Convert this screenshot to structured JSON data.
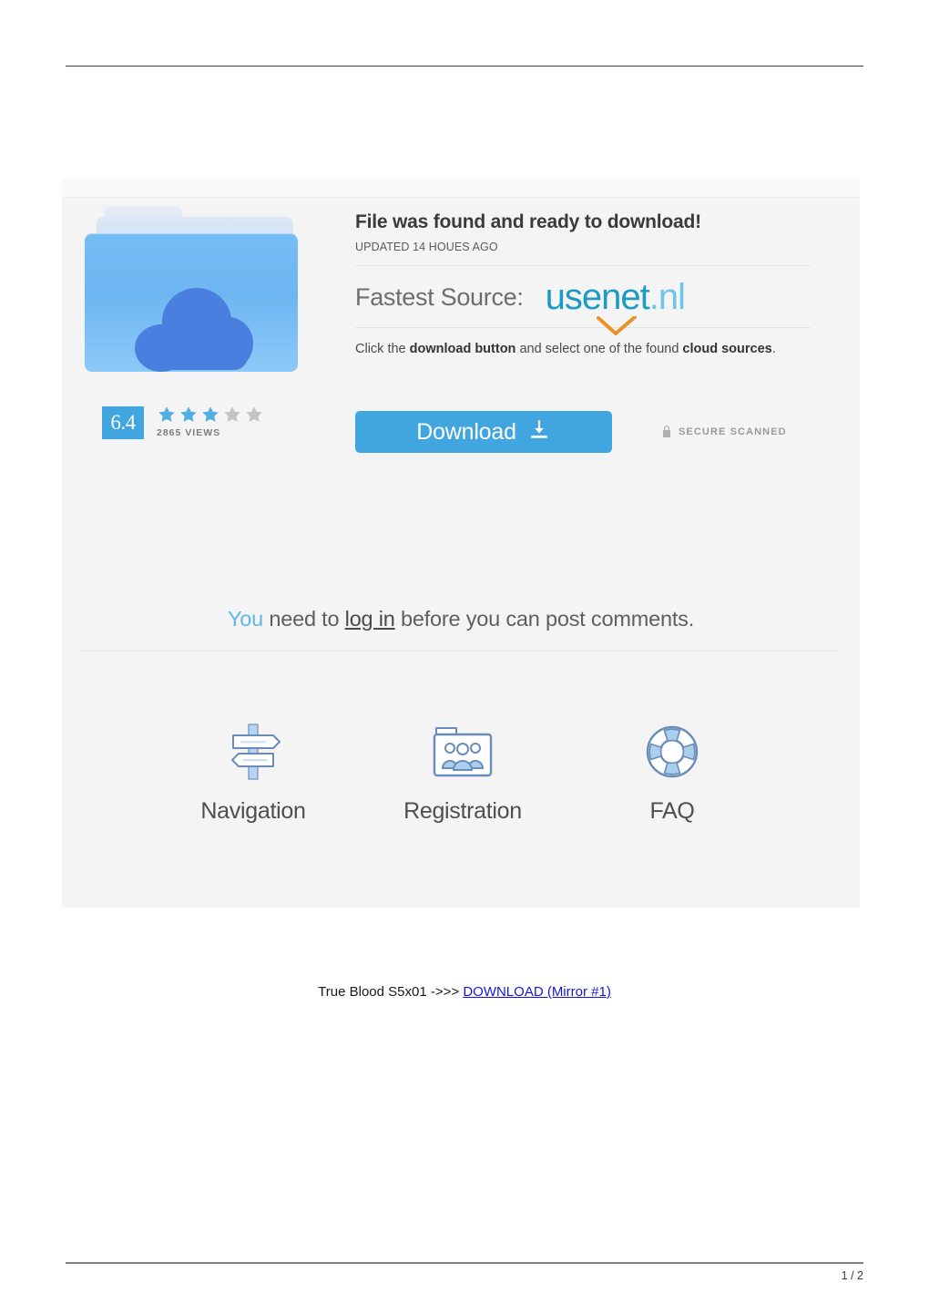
{
  "document": {
    "page_number": "1 / 2"
  },
  "ad": {
    "folder_icon": "cloud-folder-icon",
    "headline": "File was found and ready to download!",
    "updated": "UPDATED 14 HOUES AGO",
    "source_label": "Fastest Source:",
    "logo": {
      "name": "usenet-nl-logo",
      "part1": "usenet",
      "part2": ".nl",
      "color1": "#1d9bc4",
      "color2": "#6cc5e8",
      "check_color": "#e8922a"
    },
    "description": {
      "p1": "Click the ",
      "b1": "download button",
      "p2": " and select one of the found ",
      "b2": "cloud sources",
      "p3": "."
    },
    "rating": {
      "score": "6.4",
      "stars_filled": 3,
      "stars_total": 5,
      "views": "2865 VIEWS",
      "badge_color": "#41a6e0",
      "star_filled_color": "#53aee2",
      "star_empty_color": "#c3c3c3"
    },
    "download": {
      "label": "Download",
      "icon": "download-icon",
      "color": "#41a6e0"
    },
    "secure": {
      "icon": "lock-icon",
      "label": "SECURE SCANNED"
    },
    "login_message": {
      "you": "You",
      "mid": " need to ",
      "link": "log in",
      "tail": " before you can post comments."
    },
    "features": [
      {
        "icon": "signpost-icon",
        "label": "Navigation"
      },
      {
        "icon": "folder-people-icon",
        "label": "Registration"
      },
      {
        "icon": "life-ring-icon",
        "label": "FAQ"
      }
    ]
  },
  "caption": {
    "text": "True Blood S5x01 ->>> ",
    "link_text": "DOWNLOAD (Mirror #1)",
    "link_color": "#1414e6"
  }
}
